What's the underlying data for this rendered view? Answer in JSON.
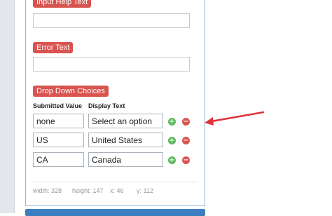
{
  "labels": {
    "input_help_text": "Input Help Text",
    "error_text": "Error Text",
    "drop_down_choices": "Drop Down Choices"
  },
  "choices_table": {
    "headers": {
      "submitted_value": "Submitted Value",
      "display_text": "Display Text"
    },
    "rows": [
      {
        "value": "none",
        "display": "Select an option"
      },
      {
        "value": "US",
        "display": "United States"
      },
      {
        "value": "CA",
        "display": "Canada"
      }
    ],
    "add_glyph": "+",
    "remove_glyph": "−"
  },
  "dimensions": {
    "width": "width: 328",
    "height": "height: 147",
    "x": "x: 46",
    "y": "y: 112"
  },
  "colors": {
    "badge": "#d9534f",
    "add": "#5cb85c",
    "remove": "#d9534f",
    "arrow": "#e0323a",
    "panel_border": "#8fb8d9",
    "bottom_bar": "#3c7fc1"
  }
}
